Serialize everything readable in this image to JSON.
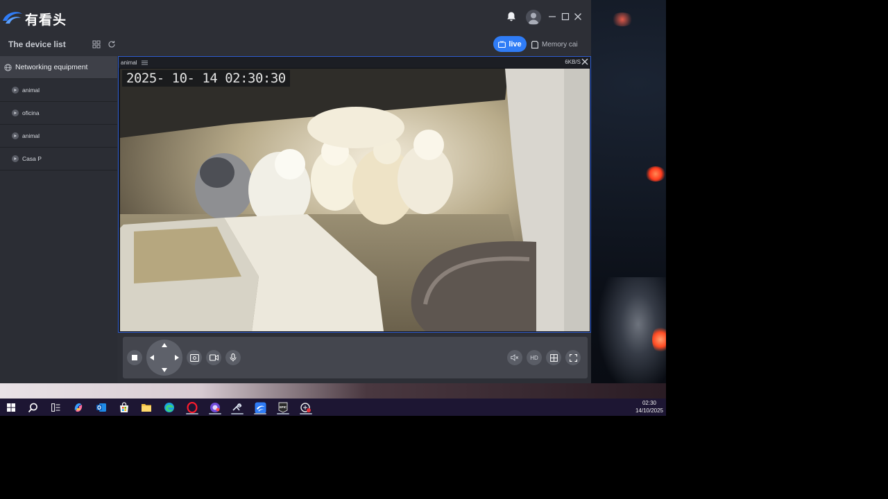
{
  "app": {
    "title": "有看头",
    "device_list_title": "The device list",
    "live_label": "live",
    "memory_tab_label": "Memory cai"
  },
  "sidebar": {
    "group_label": "Networking equipment",
    "items": [
      {
        "label": "animal"
      },
      {
        "label": "oficina"
      },
      {
        "label": "animal"
      },
      {
        "label": "Casa P"
      }
    ]
  },
  "player": {
    "channel_name": "animal",
    "bitrate": "6KB/S",
    "timestamp": "2025- 10- 14   02:30:30"
  },
  "controls": {
    "hd_label": "HD"
  },
  "taskbar": {
    "time": "02:30",
    "date": "14/10/2025"
  },
  "colors": {
    "accent": "#2f7cf6",
    "window_bg": "#2d2f36",
    "taskbar_bg": "#1d1633"
  }
}
